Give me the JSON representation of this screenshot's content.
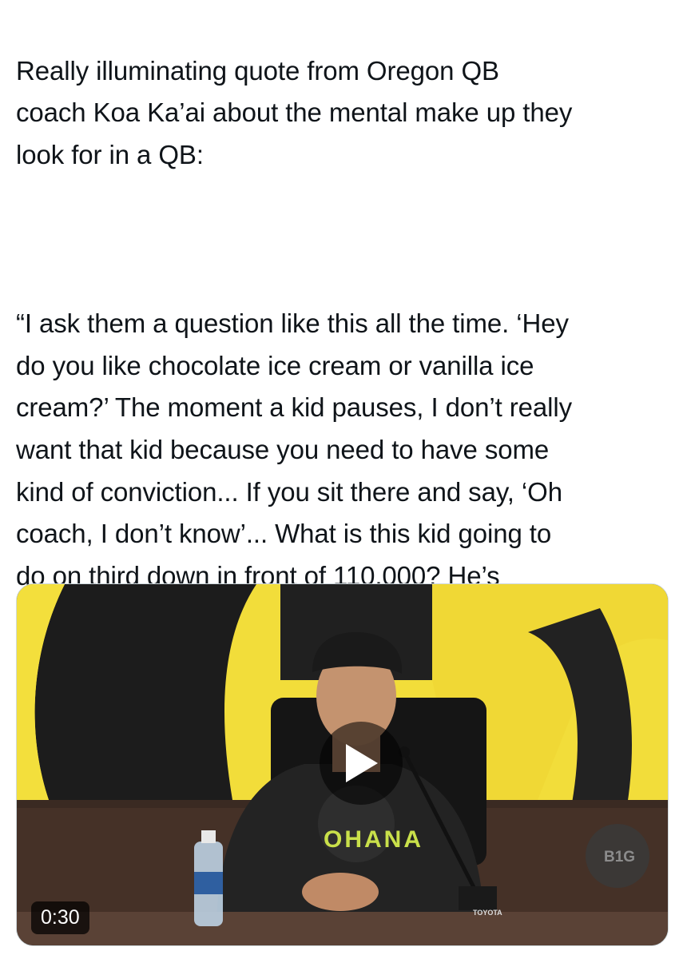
{
  "tweet": {
    "intro": "Really illuminating quote from Oregon QB\ncoach Koa Ka’ai about the mental make up they\nlook for in a QB:",
    "quote": "“I ask them a question like this all the time. ‘Hey\ndo you like chocolate ice cream or vanilla ice\ncream?’ The moment a kid pauses, I don’t really\nwant that kid because you need to have some\nkind of conviction... If you sit there and say, ‘Oh\ncoach, I don’t know’... What is this kid going to\ndo on third down in front of 110,000? He’s\nprobably going to think about it more than he\nshould.”"
  },
  "video": {
    "duration": "0:30",
    "shirt_text": "OHANA",
    "sponsor_text": "TOYOTA",
    "logo_text": "B1G",
    "play_icon": "play-icon"
  },
  "colors": {
    "text": "#0f1419",
    "oregon_yellow": "#f2dd3a",
    "oregon_black": "#1b1b1b",
    "shirt_green": "#c9e04a"
  }
}
